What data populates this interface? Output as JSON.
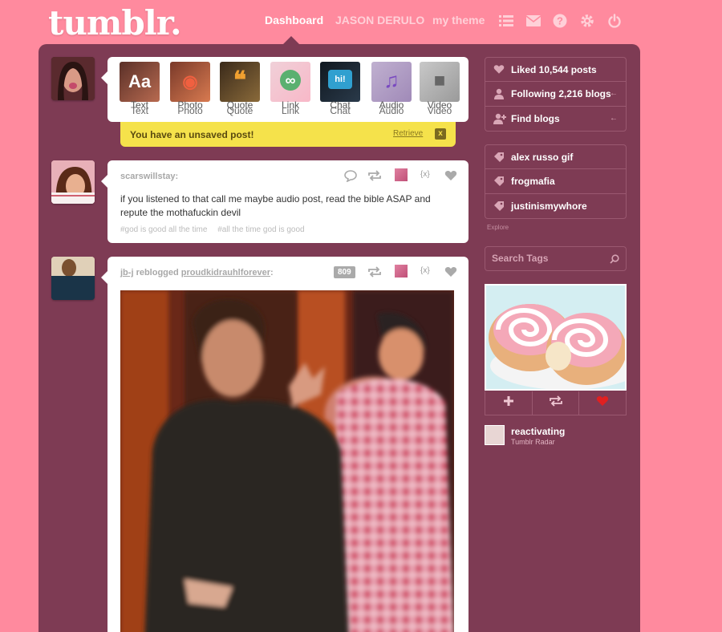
{
  "header": {
    "logo": "tumblr.",
    "nav": [
      "Dashboard",
      "JASON DERULO",
      "my theme"
    ],
    "icons": [
      "list-icon",
      "mail-icon",
      "help-icon",
      "gear-icon",
      "power-icon"
    ]
  },
  "post_types": [
    {
      "label": "Text",
      "icon": "text-icon",
      "glyph": "Aa"
    },
    {
      "label": "Photo",
      "icon": "camera-icon",
      "glyph": "◉"
    },
    {
      "label": "Quote",
      "icon": "quote-icon",
      "glyph": "❝"
    },
    {
      "label": "Link",
      "icon": "link-icon",
      "glyph": "∞"
    },
    {
      "label": "Chat",
      "icon": "chat-icon",
      "glyph": "hi!"
    },
    {
      "label": "Audio",
      "icon": "audio-icon",
      "glyph": "♫"
    },
    {
      "label": "Video",
      "icon": "video-icon",
      "glyph": "■"
    }
  ],
  "unsaved": {
    "message": "You have an unsaved post!",
    "retrieve": "Retrieve",
    "close": "x"
  },
  "posts": [
    {
      "author": "scarswillstay:",
      "text": "if you listened to that call me maybe audio post, read the bible ASAP and repute the mothafuckin devil",
      "tags": [
        "#god is good all the time",
        "#all the time god is good"
      ],
      "embed": "{x}"
    },
    {
      "author": "jb-j",
      "reblog_word": "reblogged",
      "source": "proudkidrauhlforever",
      "notes": "809",
      "embed": "{x}"
    }
  ],
  "sidebar": {
    "account": [
      {
        "label": "Liked 10,544 posts",
        "icon": "heart-icon",
        "arrow": ""
      },
      {
        "label": "Following 2,216 blogs",
        "icon": "person-icon",
        "arrow": "←"
      },
      {
        "label": "Find blogs",
        "icon": "add-person-icon",
        "arrow": "←"
      }
    ],
    "tags": [
      {
        "label": "alex russo gif",
        "icon": "tag-icon"
      },
      {
        "label": "frogmafia",
        "icon": "tag-icon"
      },
      {
        "label": "justinismywhore",
        "icon": "tag-icon"
      }
    ],
    "explore": "Explore",
    "search_placeholder": "Search Tags",
    "radar": {
      "name": "reactivating",
      "subtitle": "Tumblr Radar"
    }
  },
  "colors": {
    "page_bg": "#ff8a9e",
    "panel_bg": "#7e3b54",
    "unsaved_bg": "#f5e24b"
  }
}
